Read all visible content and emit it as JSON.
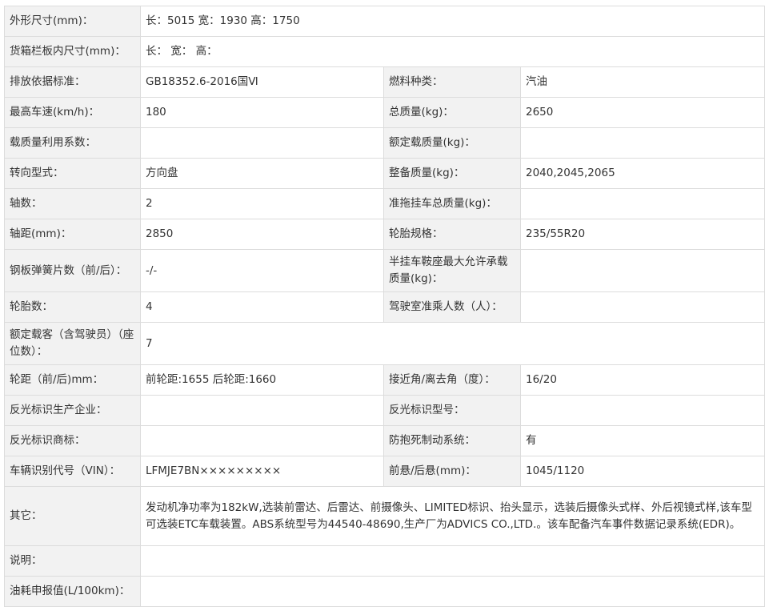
{
  "rows": [
    {
      "type": "wide",
      "label": "外形尺寸(mm)：",
      "value": "长：5015 宽：1930 高：1750"
    },
    {
      "type": "wide",
      "label": "货箱栏板内尺寸(mm)：",
      "value": "长：  宽：  高："
    },
    {
      "type": "pair",
      "label1": "排放依据标准：",
      "value1": "GB18352.6-2016国Ⅵ",
      "label2": "燃料种类：",
      "value2": "汽油"
    },
    {
      "type": "pair",
      "label1": "最高车速(km/h)：",
      "value1": "180",
      "label2": "总质量(kg)：",
      "value2": "2650"
    },
    {
      "type": "pair",
      "label1": "载质量利用系数：",
      "value1": "",
      "label2": "额定载质量(kg)：",
      "value2": ""
    },
    {
      "type": "pair",
      "label1": "转向型式：",
      "value1": "方向盘",
      "label2": "整备质量(kg)：",
      "value2": "2040,2045,2065"
    },
    {
      "type": "pair",
      "label1": "轴数：",
      "value1": "2",
      "label2": "准拖挂车总质量(kg)：",
      "value2": ""
    },
    {
      "type": "pair",
      "label1": "轴距(mm)：",
      "value1": "2850",
      "label2": "轮胎规格：",
      "value2": "235/55R20"
    },
    {
      "type": "pair",
      "label1": "钢板弹簧片数（前/后）：",
      "value1": "-/-",
      "label2": "半挂车鞍座最大允许承载质量(kg)：",
      "value2": ""
    },
    {
      "type": "pair",
      "label1": "轮胎数：",
      "value1": "4",
      "label2": "驾驶室准乘人数（人）：",
      "value2": ""
    },
    {
      "type": "wide",
      "label": "额定载客（含驾驶员）（座位数）：",
      "value": "7"
    },
    {
      "type": "pair",
      "label1": "轮距（前/后)mm：",
      "value1": "前轮距:1655 后轮距:1660",
      "label2": "接近角/离去角（度）：",
      "value2": "16/20"
    },
    {
      "type": "pair",
      "label1": "反光标识生产企业：",
      "value1": "",
      "label2": "反光标识型号：",
      "value2": ""
    },
    {
      "type": "pair",
      "label1": "反光标识商标：",
      "value1": "",
      "label2": "防抱死制动系统：",
      "value2": "有"
    },
    {
      "type": "pair",
      "label1": "车辆识别代号（VIN）：",
      "value1": "LFMJE7BN×××××××××",
      "label2": "前悬/后悬(mm)：",
      "value2": "1045/1120"
    },
    {
      "type": "wide",
      "label": "其它：",
      "value": "发动机净功率为182kW,选装前雷达、后雷达、前摄像头、LIMITED标识、抬头显示，选装后摄像头式样、外后视镜式样,该车型可选装ETC车载装置。ABS系统型号为44540-48690,生产厂为ADVICS CO.,LTD.。该车配备汽车事件数据记录系统(EDR)。"
    },
    {
      "type": "wide",
      "label": "说明：",
      "value": ""
    },
    {
      "type": "wide",
      "label": "油耗申报值(L/100km)：",
      "value": ""
    }
  ]
}
